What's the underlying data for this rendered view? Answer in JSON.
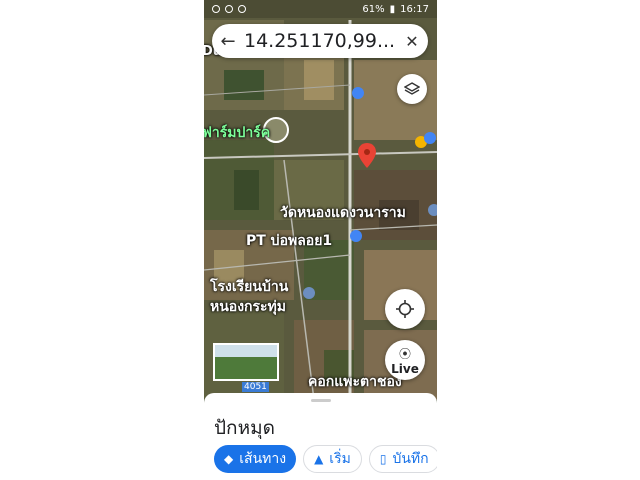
{
  "status_bar": {
    "battery": "61%",
    "time": "16:17"
  },
  "search": {
    "query": "14.251170,99....",
    "back_icon": "arrow-left-icon",
    "close_icon": "close-icon"
  },
  "map": {
    "labels": {
      "duck": "Duck Noodle...",
      "farm": "ฟาร์มปาร์ค",
      "temple": "วัดหนองแดงวนาราม",
      "pt": "PT บ่อพลอย1",
      "school_1": "โรงเรียนบ้าน",
      "school_2": "หนองกระทุ่ม",
      "khok": "คอกแพะตาชอง"
    },
    "road_number": "4051",
    "live_label": "Live"
  },
  "sheet": {
    "title": "ปักหมุด",
    "directions_label": "เส้นทาง",
    "start_label": "เริ่ม",
    "save_label": "บันทึก"
  },
  "colors": {
    "accent": "#1a73e8",
    "pin": "#ea4335"
  }
}
